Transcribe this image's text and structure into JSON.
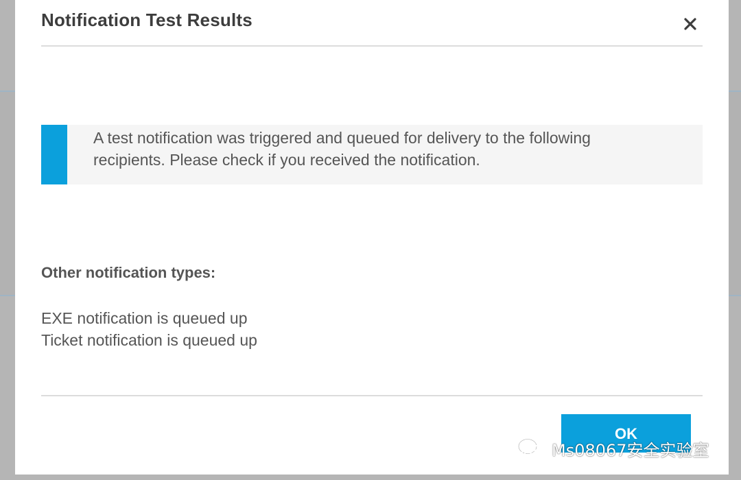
{
  "dialog": {
    "title": "Notification Test Results",
    "close_icon": "close-icon",
    "message": "A test notification was triggered and queued for delivery to the following recipients. Please check if you received the notification.",
    "other_heading": "Other notification types:",
    "statuses": [
      "EXE notification is queued up",
      "Ticket notification is queued up"
    ],
    "ok_label": "OK"
  },
  "watermark": {
    "text": "Ms08067安全实验室",
    "icon": "wechat-icon"
  },
  "colors": {
    "accent": "#0ba0dc",
    "title_text": "#3d3d3d",
    "body_text": "#555555",
    "info_background": "#f5f5f5",
    "overlay": "#b5b5b5"
  }
}
